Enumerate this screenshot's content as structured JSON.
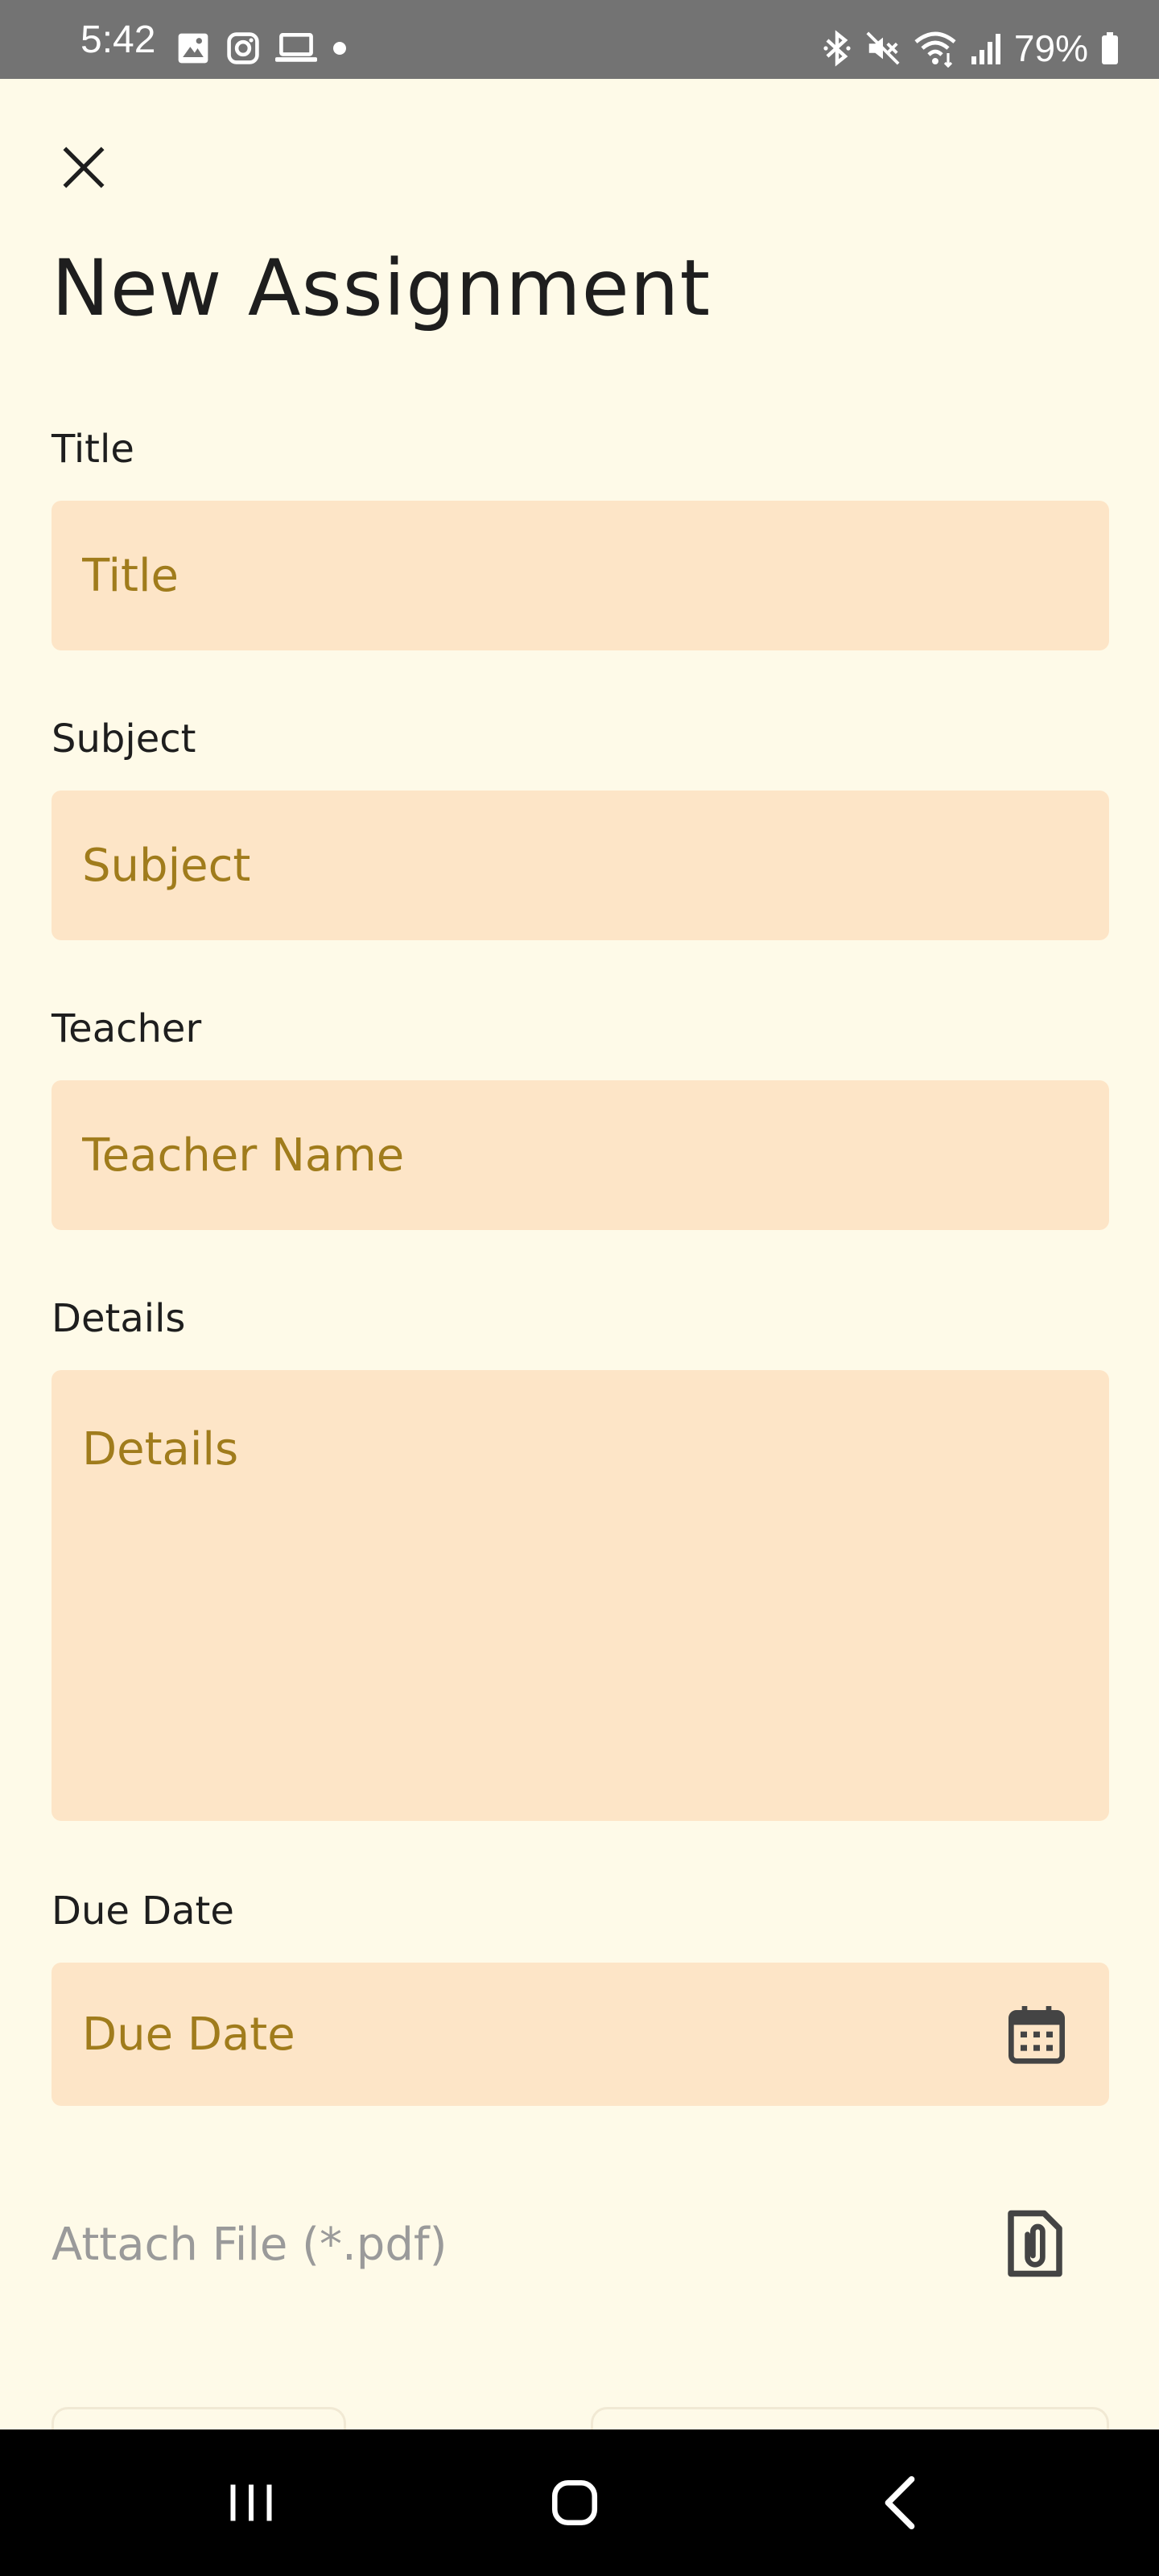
{
  "status_bar": {
    "time": "5:42",
    "battery": "79%",
    "left_icons": [
      "gallery-icon",
      "instagram-icon",
      "laptop-icon",
      "dot-icon"
    ],
    "right_icons": [
      "bluetooth-icon",
      "mute-icon",
      "wifi-icon",
      "signal-icon",
      "battery-icon"
    ]
  },
  "header": {
    "close_icon": "close-icon",
    "title": "New Assignment"
  },
  "form": {
    "title": {
      "label": "Title",
      "placeholder": "Title",
      "value": ""
    },
    "subject": {
      "label": "Subject",
      "placeholder": "Subject",
      "value": ""
    },
    "teacher": {
      "label": "Teacher",
      "placeholder": "Teacher Name",
      "value": ""
    },
    "details": {
      "label": "Details",
      "placeholder": "Details",
      "value": ""
    },
    "due_date": {
      "label": "Due Date",
      "placeholder": "Due Date",
      "value": "",
      "icon": "calendar-icon"
    },
    "attach": {
      "label": "Attach File (*.pdf)",
      "icon": "paperclip-file-icon"
    }
  },
  "nav_bar": {
    "items": [
      "recent-apps-icon",
      "home-icon",
      "back-icon"
    ]
  },
  "colors": {
    "background": "#fefae8",
    "field_fill": "#fde5c7",
    "placeholder": "#a07c1c",
    "text": "#1e1e1e",
    "status_bar": "#737373",
    "nav_bar": "#000000"
  }
}
